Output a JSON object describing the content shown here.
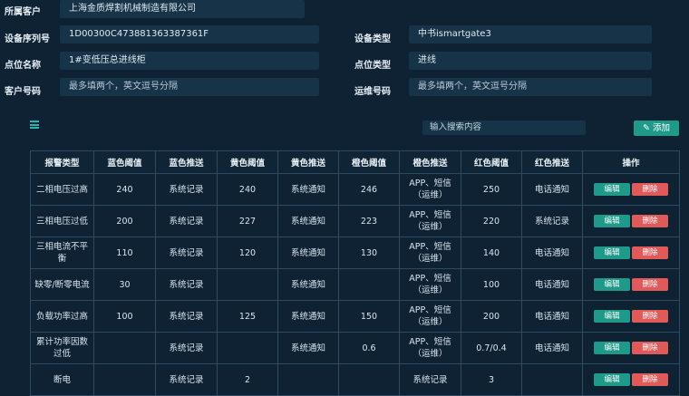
{
  "form": {
    "org_label": "所属客户",
    "org_value": "上海金质焊割机械制造有限公司",
    "serial_label": "设备序列号",
    "serial_value": "1D00300C473881363387361F",
    "device_type_label": "设备类型",
    "device_type_value": "中书ismartgate3",
    "point_name_label": "点位名称",
    "point_name_value": "1#变低压总进线柜",
    "point_type_label": "点位类型",
    "point_type_value": "进线",
    "customer_phone_label": "客户号码",
    "customer_phone_placeholder": "最多填两个，英文逗号分隔",
    "ops_phone_label": "运维号码",
    "ops_phone_placeholder": "最多填两个，英文逗号分隔"
  },
  "toolbar": {
    "search_placeholder": "输入搜索内容",
    "add_label": "添加"
  },
  "table": {
    "headers": [
      "报警类型",
      "蓝色阈值",
      "蓝色推送",
      "黄色阈值",
      "黄色推送",
      "橙色阈值",
      "橙色推送",
      "红色阈值",
      "红色推送",
      "操作"
    ],
    "edit_label": "编辑",
    "delete_label": "删除",
    "rows": [
      [
        "二相电压过高",
        "240",
        "系统记录",
        "240",
        "系统通知",
        "246",
        "APP、短信（运维）",
        "250",
        "电话通知"
      ],
      [
        "三相电压过低",
        "200",
        "系统记录",
        "227",
        "系统通知",
        "223",
        "APP、短信（运维）",
        "220",
        "系统记录"
      ],
      [
        "三相电流不平衡",
        "110",
        "系统记录",
        "120",
        "系统通知",
        "130",
        "APP、短信（运维）",
        "140",
        "电话通知"
      ],
      [
        "缺零/断零电流",
        "30",
        "系统记录",
        "",
        "系统通知",
        "",
        "APP、短信（运维）",
        "100",
        "电话通知"
      ],
      [
        "负载功率过高",
        "100",
        "系统记录",
        "125",
        "系统通知",
        "150",
        "APP、短信（运维）",
        "200",
        "电话通知"
      ],
      [
        "累计功率因数过低",
        "",
        "系统记录",
        "",
        "系统通知",
        "0.6",
        "APP、短信（运维）",
        "0.7/0.4",
        "电话通知"
      ],
      [
        "断电",
        "",
        "系统记录",
        "2",
        "",
        "",
        "系统记录",
        "3",
        ""
      ]
    ]
  }
}
